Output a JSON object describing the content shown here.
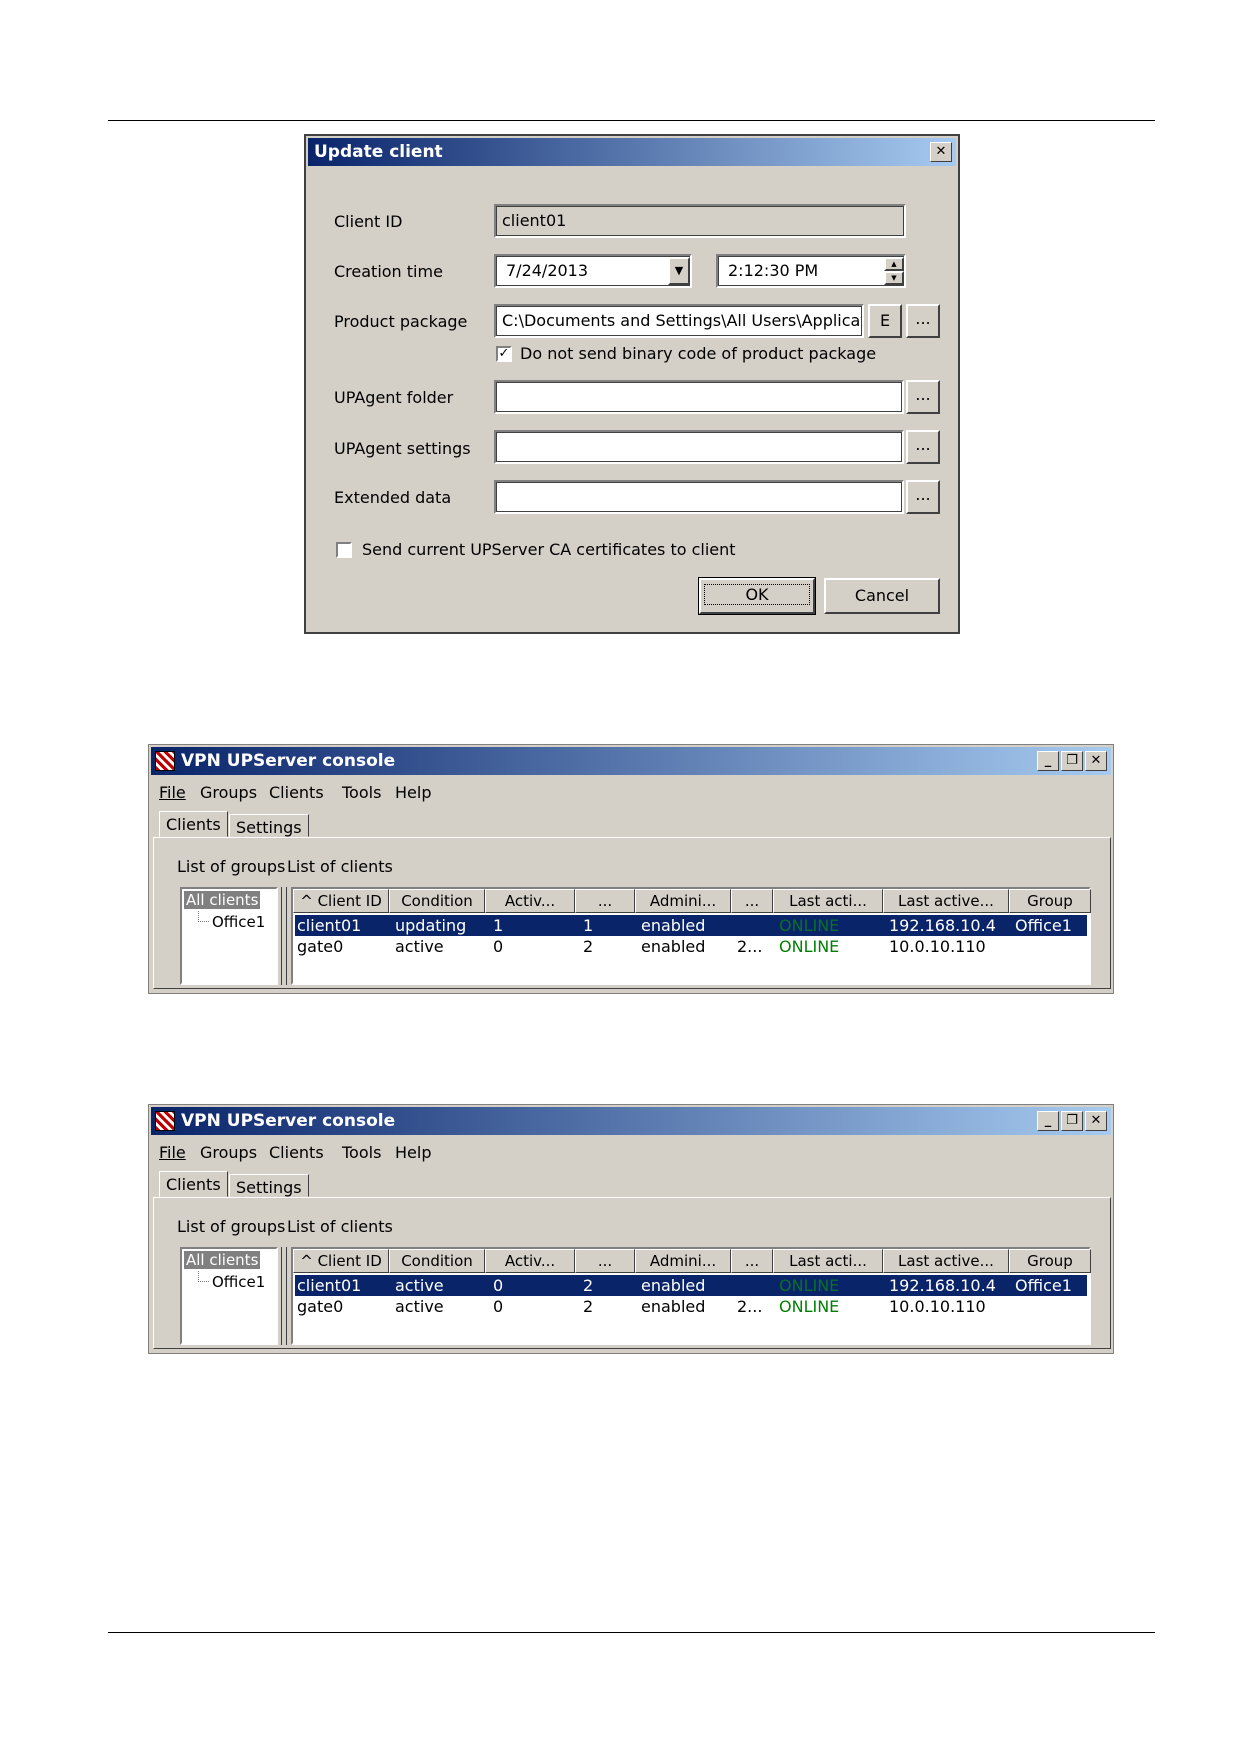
{
  "dialog": {
    "title": "Update client",
    "close_glyph": "✕",
    "client_id_label": "Client ID",
    "client_id_value": "client01",
    "creation_time_label": "Creation time",
    "date_value": "7/24/2013",
    "time_value": "2:12:30 PM",
    "product_package_label": "Product package",
    "product_package_value": "C:\\Documents and Settings\\All Users\\Application",
    "e_button": "E",
    "browse_label": "...",
    "no_binary_checkbox": "Do not send binary code of product package",
    "no_binary_checked": true,
    "upagent_folder_label": "UPAgent folder",
    "upagent_settings_label": "UPAgent settings",
    "extended_data_label": "Extended data",
    "send_ca_checkbox": "Send current UPServer CA certificates to client",
    "send_ca_checked": false,
    "ok_label": "OK",
    "cancel_label": "Cancel"
  },
  "console_common": {
    "title": "VPN UPServer console",
    "menu": [
      "File",
      "Groups",
      "Clients",
      "Tools",
      "Help"
    ],
    "tabs": [
      "Clients",
      "Settings"
    ],
    "list_of_groups": "List of groups",
    "list_of_clients": "List of clients",
    "groups": [
      "All clients",
      "Office1"
    ],
    "columns": [
      "^ Client ID",
      "Condition",
      "Activ...",
      "...",
      "Admini...",
      "...",
      "Last acti...",
      "Last active...",
      "Group"
    ]
  },
  "console1": {
    "rows": [
      [
        "client01",
        "updating",
        "1",
        "1",
        "enabled",
        "",
        "ONLINE",
        "192.168.10.4",
        "Office1"
      ],
      [
        "gate0",
        "active",
        "0",
        "2",
        "enabled",
        "2...",
        "ONLINE",
        "10.0.10.110",
        ""
      ]
    ]
  },
  "console2": {
    "rows": [
      [
        "client01",
        "active",
        "0",
        "2",
        "enabled",
        "",
        "ONLINE",
        "192.168.10.4",
        "Office1"
      ],
      [
        "gate0",
        "active",
        "0",
        "2",
        "enabled",
        "2...",
        "ONLINE",
        "10.0.10.110",
        ""
      ]
    ]
  }
}
